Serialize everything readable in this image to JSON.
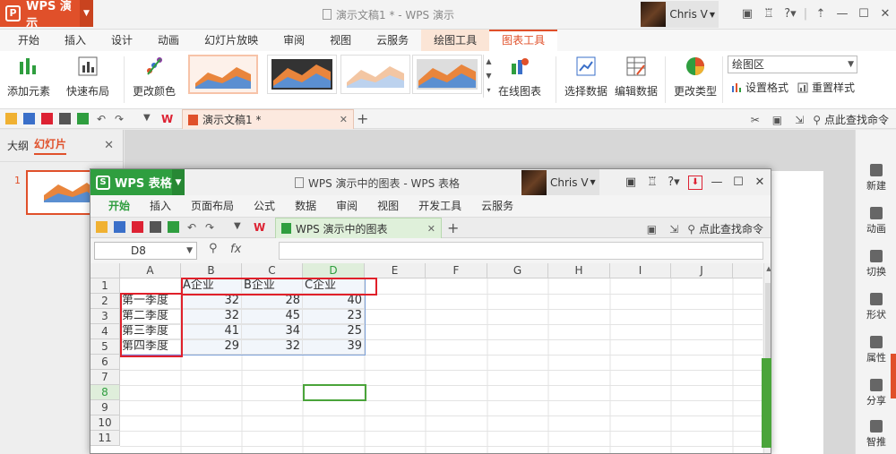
{
  "pres": {
    "app_name": "WPS 演示",
    "title": "演示文稿1 * - WPS 演示",
    "user": "Chris V",
    "tabs": [
      "开始",
      "插入",
      "设计",
      "动画",
      "幻灯片放映",
      "审阅",
      "视图",
      "云服务",
      "绘图工具",
      "图表工具"
    ],
    "ribbon": {
      "add_element": "添加元素",
      "quick_layout": "快速布局",
      "change_color": "更改颜色",
      "online_chart": "在线图表",
      "select_data": "选择数据",
      "edit_data": "编辑数据",
      "change_type": "更改类型",
      "chart_area_combo": "绘图区",
      "set_format": "设置格式",
      "reset_style": "重置样式"
    },
    "doc_tab": "演示文稿1 *",
    "find_cmd": "点此查找命令",
    "panel_tabs": [
      "大纲",
      "幻灯片"
    ],
    "slide_number": "1",
    "task_pane": [
      "新建",
      "动画",
      "切换",
      "形状",
      "属性",
      "分享",
      "智推"
    ]
  },
  "sheet": {
    "app_name": "WPS 表格",
    "title": "WPS 演示中的图表 - WPS 表格",
    "user": "Chris V",
    "tabs": [
      "开始",
      "插入",
      "页面布局",
      "公式",
      "数据",
      "审阅",
      "视图",
      "开发工具",
      "云服务"
    ],
    "doc_tab": "WPS 演示中的图表",
    "find_cmd": "点此查找命令",
    "name_box": "D8",
    "fx": "fx",
    "columns": [
      "A",
      "B",
      "C",
      "D",
      "E",
      "F",
      "G",
      "H",
      "I",
      "J"
    ],
    "rows": [
      "1",
      "2",
      "3",
      "4",
      "5",
      "6",
      "7",
      "8",
      "9",
      "10",
      "11"
    ],
    "header_row": [
      "",
      "A企业",
      "B企业",
      "C企业"
    ],
    "data_rows": [
      {
        "label": "第一季度",
        "b": "32",
        "c": "28",
        "d": "40"
      },
      {
        "label": "第二季度",
        "b": "32",
        "c": "45",
        "d": "23"
      },
      {
        "label": "第三季度",
        "b": "41",
        "c": "34",
        "d": "25"
      },
      {
        "label": "第四季度",
        "b": "29",
        "c": "32",
        "d": "39"
      }
    ]
  }
}
